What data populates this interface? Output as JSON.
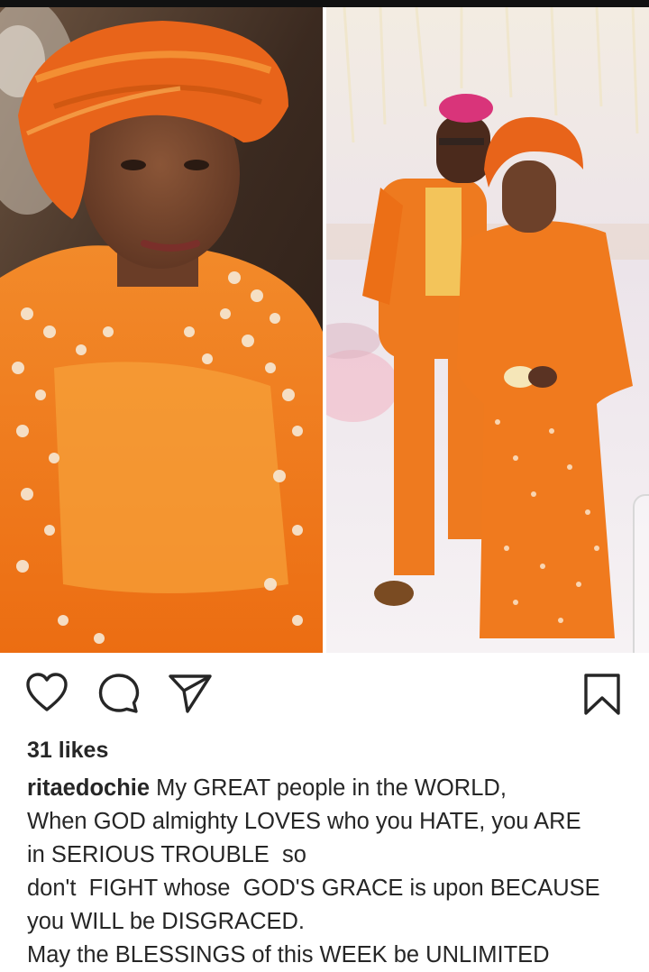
{
  "post": {
    "likes_text": "31 likes",
    "username": "ritaedochie",
    "caption_lines": [
      " My GREAT people in the WORLD,",
      "When GOD almighty LOVES who you HATE, you ARE",
      "in SERIOUS TROUBLE  so",
      "don't  FIGHT whose  GOD'S GRACE is upon BECAUSE",
      "you WILL be DISGRACED.",
      "May the BLESSINGS of this WEEK be UNLIMITED"
    ]
  },
  "actions": {
    "like_icon": "heart-icon",
    "comment_icon": "comment-icon",
    "share_icon": "send-icon",
    "save_icon": "bookmark-icon"
  },
  "colors": {
    "text": "#262626",
    "accent_orange": "#f07a1e",
    "headwrap_orange": "#e8641a"
  }
}
